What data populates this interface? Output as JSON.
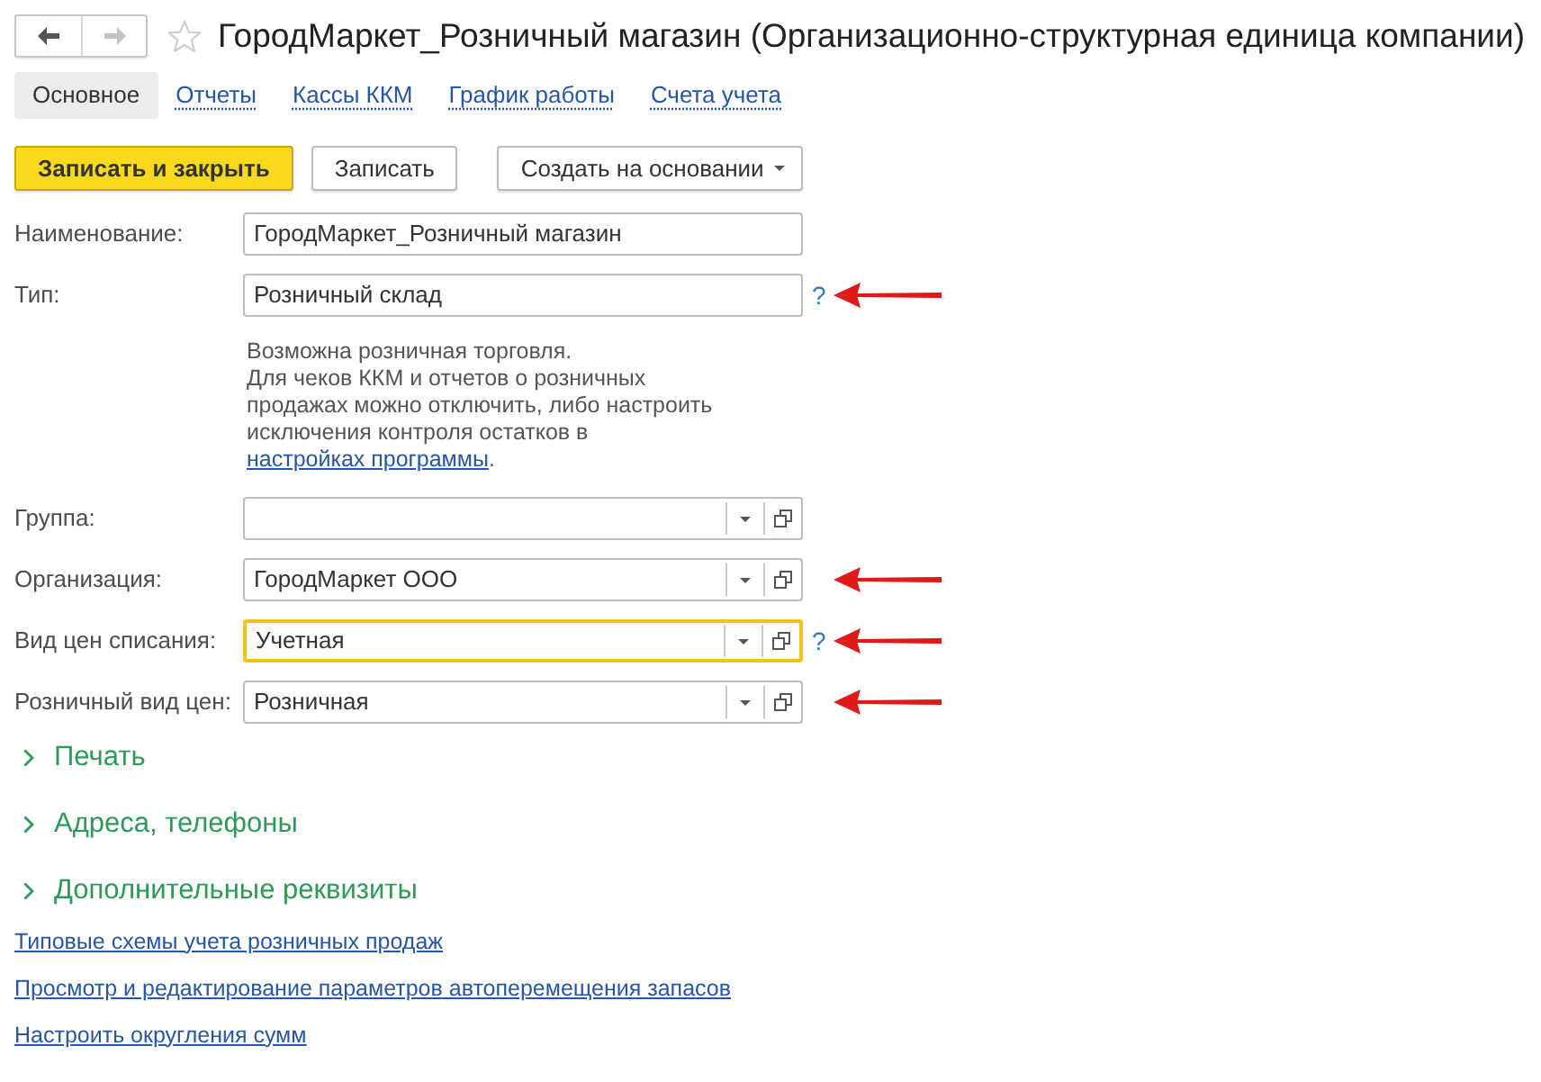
{
  "window": {
    "title": "ГородМаркет_Розничный магазин (Организационно-структурная единица компании)",
    "favorite": false
  },
  "navigation": [
    {
      "kind": "back",
      "disabled": false
    },
    {
      "kind": "forward",
      "disabled": true
    }
  ],
  "tabs": [
    {
      "label": "Основное",
      "selected": true
    },
    {
      "label": "Отчеты",
      "selected": false
    },
    {
      "label": "Кассы ККМ",
      "selected": false
    },
    {
      "label": "График работы",
      "selected": false
    },
    {
      "label": "Счета учета",
      "selected": false
    }
  ],
  "toolbar": [
    {
      "label": "Записать и закрыть",
      "kind": "primary"
    },
    {
      "label": "Записать",
      "kind": "default"
    },
    {
      "label": "Создать на основании",
      "kind": "menu"
    }
  ],
  "fields": [
    {
      "label": "Наименование:",
      "kind": "text",
      "value": "ГородМаркет_Розничный магазин",
      "focused": false,
      "annotation_arrow": false
    },
    {
      "label": "Тип:",
      "kind": "text",
      "value": "Розничный склад",
      "focused": false,
      "help": "?",
      "annotation_arrow": true,
      "note": {
        "first_line": "Возможна розничная торговля.",
        "text": "Для чеков ККМ и отчетов о розничных продажах можно отключить, либо настроить исключения контроля остатков в",
        "link": "настройках программы",
        "after_link": "."
      }
    },
    {
      "label": "Группа:",
      "kind": "select",
      "focused": false,
      "annotation_arrow": false
    },
    {
      "label": "Организация:",
      "kind": "select",
      "value": "ГородМаркет ООО",
      "focused": false,
      "annotation_arrow": true
    },
    {
      "label": "Вид цен списания:",
      "kind": "select",
      "value": "Учетная",
      "focused": true,
      "help": "?",
      "annotation_arrow": true
    },
    {
      "label": "Розничный вид цен:",
      "kind": "select",
      "value": "Розничная",
      "focused": false,
      "annotation_arrow": true
    }
  ],
  "sections": [
    {
      "label": "Печать",
      "expanded": false
    },
    {
      "label": "Адреса, телефоны",
      "expanded": false
    },
    {
      "label": "Дополнительные реквизиты",
      "expanded": false
    }
  ],
  "links": [
    "Типовые схемы учета розничных продаж",
    "Просмотр и редактирование параметров автоперемещения запасов",
    "Настроить округления сумм"
  ]
}
